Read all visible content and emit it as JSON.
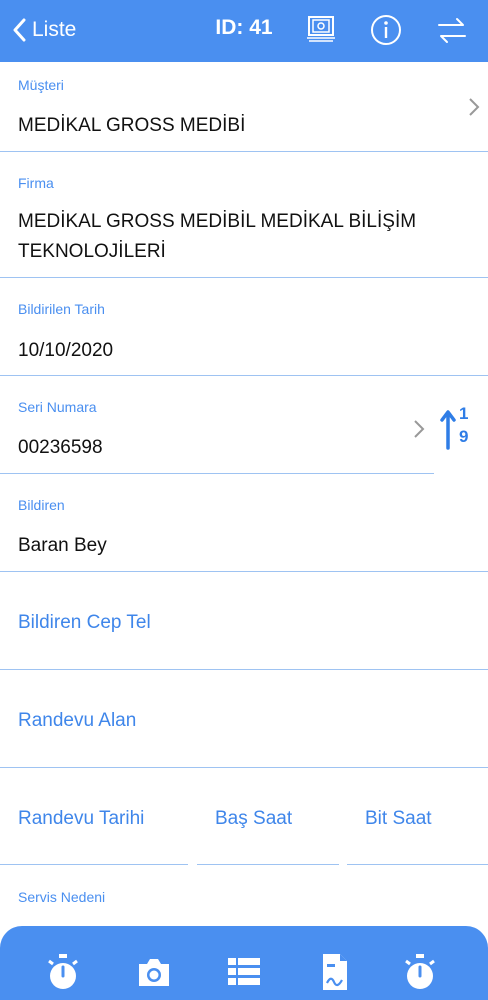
{
  "nav": {
    "back_label": "Liste",
    "title": "ID: 41"
  },
  "fields": {
    "musteri": {
      "label": "Müşteri",
      "value": "MEDİKAL GROSS MEDİBİ"
    },
    "firma": {
      "label": "Firma",
      "value_line1": "MEDİKAL GROSS MEDİBİL MEDİKAL BİLİŞİM",
      "value_line2": "TEKNOLOJİLERİ"
    },
    "bildirilen_tarih": {
      "label": "Bildirilen Tarih",
      "value": "10/10/2020"
    },
    "seri_numara": {
      "label": "Seri Numara",
      "value": "00236598"
    },
    "bildiren": {
      "label": "Bildiren",
      "value": "Baran Bey"
    },
    "bildiren_cep_tel": {
      "placeholder": "Bildiren Cep Tel"
    },
    "randevu_alan": {
      "placeholder": "Randevu Alan"
    },
    "randevu_tarihi": {
      "placeholder": "Randevu Tarihi"
    },
    "bas_saat": {
      "placeholder": "Baş Saat"
    },
    "bit_saat": {
      "placeholder": "Bit Saat"
    },
    "servis_nedeni": {
      "label": "Servis Nedeni"
    }
  },
  "sort_icon_digits": {
    "top": "1",
    "bottom": "9"
  },
  "colors": {
    "accent": "#4a8ff0",
    "divider": "#9ec3f2",
    "text": "#111111"
  },
  "icons": [
    "back-chevron-icon",
    "photos-icon",
    "info-icon",
    "swap-arrows-icon",
    "chevron-right-icon",
    "sort-ascending-icon",
    "stopwatch-icon",
    "camera-icon",
    "list-icon",
    "document-signature-icon"
  ]
}
